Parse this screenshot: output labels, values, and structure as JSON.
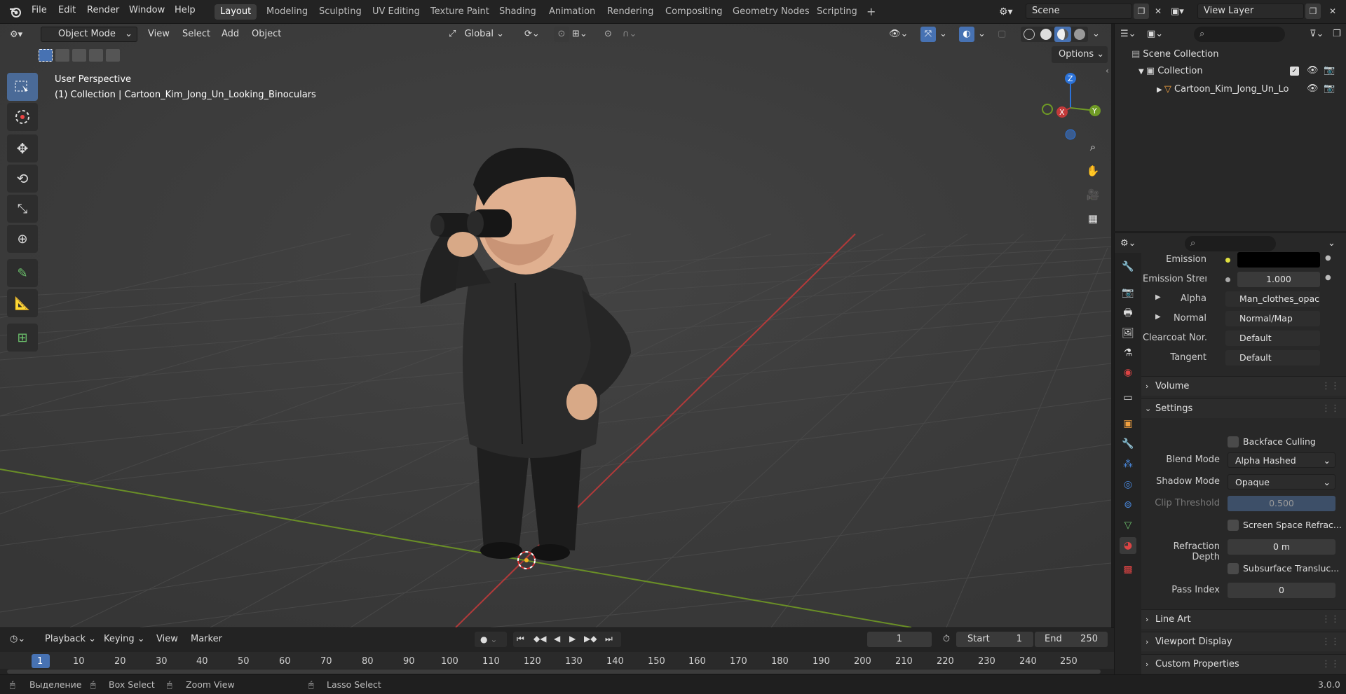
{
  "topbar": {
    "menus": [
      "File",
      "Edit",
      "Render",
      "Window",
      "Help"
    ],
    "workspaces": [
      "Layout",
      "Modeling",
      "Sculpting",
      "UV Editing",
      "Texture Paint",
      "Shading",
      "Animation",
      "Rendering",
      "Compositing",
      "Geometry Nodes",
      "Scripting"
    ],
    "active_workspace": "Layout",
    "add_tab": "+",
    "scene": "Scene",
    "view_layer": "View Layer"
  },
  "viewport_header": {
    "mode": "Object Mode",
    "menus": [
      "View",
      "Select",
      "Add",
      "Object"
    ],
    "transform": "Global",
    "options": "Options"
  },
  "viewport": {
    "perspective": "User Perspective",
    "collection_info": "(1) Collection | Cartoon_Kim_Jong_Un_Looking_Binoculars",
    "gizmo": {
      "z": "Z",
      "x": "X",
      "y": "Y"
    }
  },
  "outliner": {
    "scene_collection": "Scene Collection",
    "collection": "Collection",
    "object": "Cartoon_Kim_Jong_Un_Lo"
  },
  "properties": {
    "rows": [
      {
        "label": "Emission",
        "value": ""
      },
      {
        "label": "Emission Stren...",
        "value": "1.000"
      },
      {
        "label": "Alpha",
        "value": "Man_clothes_opac..."
      },
      {
        "label": "Normal",
        "value": "Normal/Map"
      },
      {
        "label": "Clearcoat Nor...",
        "value": "Default"
      },
      {
        "label": "Tangent",
        "value": "Default"
      }
    ],
    "volume": "Volume",
    "settings": "Settings",
    "backface_culling": "Backface Culling",
    "blend_mode_label": "Blend Mode",
    "blend_mode": "Alpha Hashed",
    "shadow_mode_label": "Shadow Mode",
    "shadow_mode": "Opaque",
    "clip_threshold_label": "Clip Threshold",
    "clip_threshold": "0.500",
    "screen_space": "Screen Space Refrac...",
    "refraction_depth_label": "Refraction Depth",
    "refraction_depth": "0 m",
    "subsurface": "Subsurface Transluc...",
    "pass_index_label": "Pass Index",
    "pass_index": "0",
    "line_art": "Line Art",
    "viewport_display": "Viewport Display",
    "custom_properties": "Custom Properties"
  },
  "timeline": {
    "playback": "Playback",
    "keying": "Keying",
    "view": "View",
    "marker": "Marker",
    "current_frame": "1",
    "start_label": "Start",
    "start": "1",
    "end_label": "End",
    "end": "250",
    "ruler": [
      "1",
      "10",
      "20",
      "30",
      "40",
      "50",
      "60",
      "70",
      "80",
      "90",
      "100",
      "110",
      "120",
      "130",
      "140",
      "150",
      "160",
      "170",
      "180",
      "190",
      "200",
      "210",
      "220",
      "230",
      "240",
      "250"
    ]
  },
  "statusbar": {
    "select": "Выделение",
    "box_select": "Box Select",
    "zoom_view": "Zoom View",
    "lasso_select": "Lasso Select",
    "version": "3.0.0"
  },
  "colors": {
    "accent": "#4772b3",
    "x_axis": "#c23a3a",
    "y_axis": "#6f9a25",
    "z_axis": "#2b72d8"
  }
}
